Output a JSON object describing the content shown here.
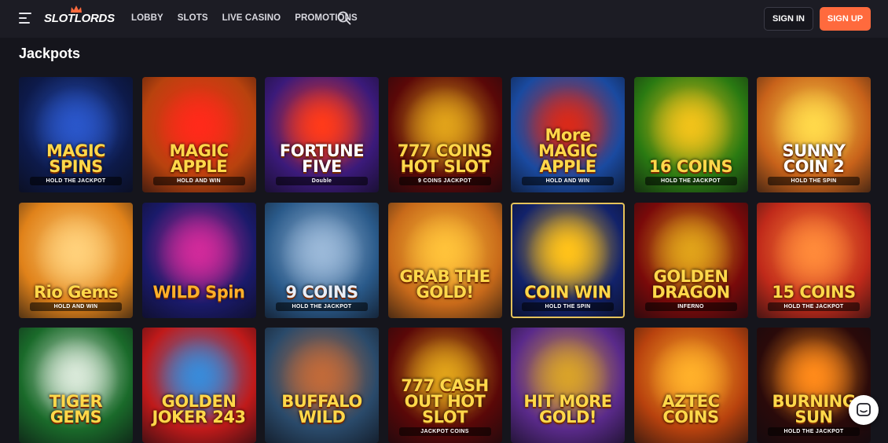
{
  "header": {
    "logo_text": "SLOTLORDS",
    "nav": [
      "LOBBY",
      "SLOTS",
      "LIVE CASINO",
      "PROMOTIONS"
    ],
    "signin_label": "SIGN IN",
    "signup_label": "SIGN UP"
  },
  "section": {
    "title": "Jackpots"
  },
  "games": [
    {
      "title": "MAGIC SPINS",
      "sub": "HOLD THE JACKPOT",
      "bg": "#0d1a4a",
      "glow": "#2a56c9",
      "color": "#ffd84a"
    },
    {
      "title": "MAGIC APPLE",
      "sub": "HOLD AND WIN",
      "bg": "#b8420e",
      "glow": "#ff2a1a",
      "color": "#ffd84a"
    },
    {
      "title": "FORTUNE FIVE",
      "sub": "Double",
      "bg": "#3b1a7a",
      "glow": "#ff3a1a",
      "color": "#ffffff"
    },
    {
      "title": "777 COINS HOT SLOT",
      "sub": "9 COINS JACKPOT",
      "bg": "#5a0808",
      "glow": "#e0a21a",
      "color": "#ffd84a"
    },
    {
      "title": "More MAGIC APPLE",
      "sub": "HOLD AND WIN",
      "bg": "#1a4aa0",
      "glow": "#d92a1a",
      "color": "#ffd84a"
    },
    {
      "title": "16 COINS",
      "sub": "HOLD THE JACKPOT",
      "bg": "#2a7a12",
      "glow": "#f0c21a",
      "color": "#ffd84a"
    },
    {
      "title": "SUNNY COIN 2",
      "sub": "HOLD THE SPIN",
      "bg": "#c8621a",
      "glow": "#ffd84a",
      "color": "#ffffff"
    },
    {
      "title": "Rio Gems",
      "sub": "HOLD AND WIN",
      "bg": "#e0821a",
      "glow": "#ffd07a",
      "color": "#ffd84a"
    },
    {
      "title": "WILD Spin",
      "sub": "",
      "bg": "#1a1a6a",
      "glow": "#d02a9a",
      "color": "#ffb02a"
    },
    {
      "title": "9 COINS",
      "sub": "HOLD THE JACKPOT",
      "bg": "#2a5a8a",
      "glow": "#9ab8d8",
      "color": "#e8eef8"
    },
    {
      "title": "GRAB THE GOLD!",
      "sub": "",
      "bg": "#c86a1a",
      "glow": "#ffc23a",
      "color": "#ffd84a"
    },
    {
      "title": "COIN WIN",
      "sub": "HOLD THE SPIN",
      "bg": "#12226a",
      "glow": "#ffc21a",
      "color": "#ffd84a"
    },
    {
      "title": "GOLDEN DRAGON",
      "sub": "INFERNO",
      "bg": "#7a0a0a",
      "glow": "#e0a21a",
      "color": "#ffd84a"
    },
    {
      "title": "15 COINS",
      "sub": "HOLD THE JACKPOT",
      "bg": "#c02a1a",
      "glow": "#ff8a3a",
      "color": "#ffd84a"
    },
    {
      "title": "TIGER GEMS",
      "sub": "",
      "bg": "#1a6a2a",
      "glow": "#d8e8d8",
      "color": "#ffd84a"
    },
    {
      "title": "GOLDEN JOKER 243",
      "sub": "",
      "bg": "#c01a1a",
      "glow": "#3a8ad8",
      "color": "#ffd84a"
    },
    {
      "title": "BUFFALO WILD",
      "sub": "",
      "bg": "#2a4a6a",
      "glow": "#c06a3a",
      "color": "#ffd84a"
    },
    {
      "title": "777 CASH OUT HOT SLOT",
      "sub": "JACKPOT COINS",
      "bg": "#5a0808",
      "glow": "#e0a21a",
      "color": "#ffd84a"
    },
    {
      "title": "HIT MORE GOLD!",
      "sub": "",
      "bg": "#5a2a8a",
      "glow": "#d8a22a",
      "color": "#ffd84a"
    },
    {
      "title": "AZTEC COINS",
      "sub": "",
      "bg": "#b8420e",
      "glow": "#ffb02a",
      "color": "#ffd84a"
    },
    {
      "title": "BURNING SUN",
      "sub": "HOLD THE JACKPOT",
      "bg": "#2a0a0a",
      "glow": "#ff8a1a",
      "color": "#ffd84a"
    }
  ]
}
